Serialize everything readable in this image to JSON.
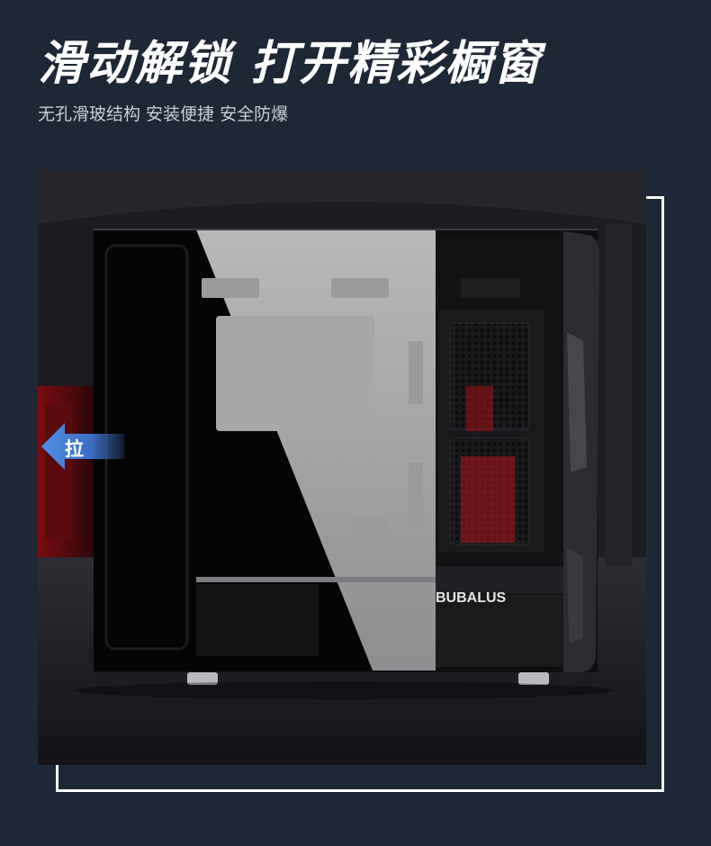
{
  "header": {
    "headline": "滑动解锁  打开精彩橱窗",
    "subtitle": "无孔滑玻结构 安装便捷 安全防爆"
  },
  "product": {
    "brand": "BUBALUS"
  },
  "pull_tag": {
    "label": "拉"
  },
  "colors": {
    "background": "#1e2735",
    "arrow_blue": "#3f7fd6",
    "accent_red": "#b5161a",
    "frame_white": "#ffffff"
  }
}
